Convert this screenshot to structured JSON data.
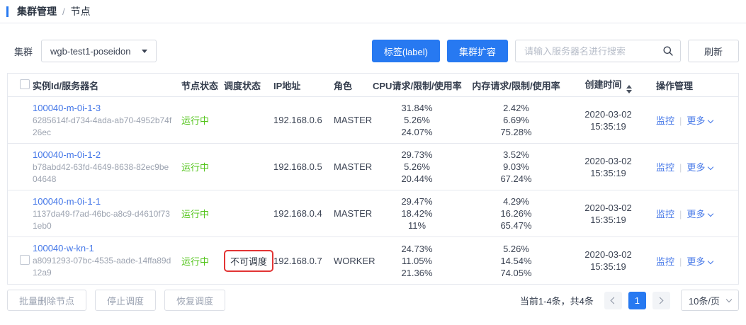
{
  "colors": {
    "primary": "#2779f1",
    "link": "#4477e8",
    "success": "#52c41a",
    "danger": "#e23434"
  },
  "icons": {
    "search": "magnifier",
    "select_caret": "caret-down",
    "sort": "sort-arrows-up-down",
    "more_chevron": "chevron-down",
    "prev": "chevron-left",
    "next": "chevron-right",
    "page_size_caret": "chevron-down"
  },
  "breadcrumb": {
    "section": "集群管理",
    "separator": "/",
    "current": "节点"
  },
  "toolbar": {
    "cluster_label": "集群",
    "cluster_selected": "wgb-test1-poseidon",
    "label_button": "标签(label)",
    "expand_button": "集群扩容",
    "search_placeholder": "请输入服务器名进行搜索",
    "refresh_button": "刷新"
  },
  "table": {
    "columns": [
      "实例Id/服务器名",
      "节点状态",
      "调度状态",
      "IP地址",
      "角色",
      "CPU请求/限制/使用率",
      "内存请求/限制/使用率",
      "创建时间",
      "操作管理"
    ],
    "action_labels": {
      "monitor": "监控",
      "divider": "|",
      "more": "更多"
    },
    "rows": [
      {
        "name": "100040-m-0i-1-3",
        "uuid": "6285614f-d734-4ada-ab70-4952b74f26ec",
        "node_status": "运行中",
        "sched_status": "",
        "ip": "192.168.0.6",
        "role": "MASTER",
        "cpu": [
          "31.84%",
          "5.26%",
          "24.07%"
        ],
        "mem": [
          "2.42%",
          "6.69%",
          "75.28%"
        ],
        "created_date": "2020-03-02",
        "created_time": "15:35:19",
        "has_checkbox": false,
        "sched_highlight": false
      },
      {
        "name": "100040-m-0i-1-2",
        "uuid": "b78abd42-63fd-4649-8638-82ec9be04648",
        "node_status": "运行中",
        "sched_status": "",
        "ip": "192.168.0.5",
        "role": "MASTER",
        "cpu": [
          "29.73%",
          "5.26%",
          "20.44%"
        ],
        "mem": [
          "3.52%",
          "9.03%",
          "67.24%"
        ],
        "created_date": "2020-03-02",
        "created_time": "15:35:19",
        "has_checkbox": false,
        "sched_highlight": false
      },
      {
        "name": "100040-m-0i-1-1",
        "uuid": "1137da49-f7ad-46bc-a8c9-d4610f731eb0",
        "node_status": "运行中",
        "sched_status": "",
        "ip": "192.168.0.4",
        "role": "MASTER",
        "cpu": [
          "29.47%",
          "18.42%",
          "11%"
        ],
        "mem": [
          "4.29%",
          "16.26%",
          "65.47%"
        ],
        "created_date": "2020-03-02",
        "created_time": "15:35:19",
        "has_checkbox": false,
        "sched_highlight": false
      },
      {
        "name": "100040-w-kn-1",
        "uuid": "a8091293-07bc-4535-aade-14ffa89d12a9",
        "node_status": "运行中",
        "sched_status": "不可调度",
        "ip": "192.168.0.7",
        "role": "WORKER",
        "cpu": [
          "24.73%",
          "11.05%",
          "21.36%"
        ],
        "mem": [
          "5.26%",
          "14.54%",
          "74.05%"
        ],
        "created_date": "2020-03-02",
        "created_time": "15:35:19",
        "has_checkbox": true,
        "sched_highlight": true
      }
    ]
  },
  "footer": {
    "batch_delete_button": "批量删除节点",
    "stop_schedule_button": "停止调度",
    "resume_schedule_button": "恢复调度",
    "pagination": {
      "summary": "当前1-4条，共4条",
      "current_page": "1",
      "page_size": "10条/页"
    }
  }
}
